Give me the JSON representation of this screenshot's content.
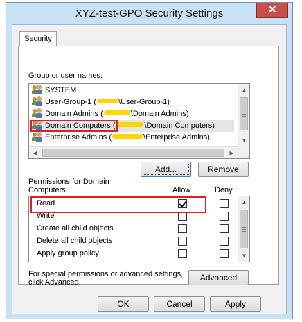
{
  "window": {
    "title": "XYZ-test-GPO Security Settings",
    "close_glyph": "✕"
  },
  "tabs": [
    {
      "label": "Security",
      "active": true
    }
  ],
  "group_section": {
    "label": "Group or user names:",
    "items": [
      {
        "prefix": "SYSTEM",
        "suffix": "",
        "redacted": false,
        "selected": false,
        "icon": "group-icon"
      },
      {
        "prefix": "User-Group-1 (",
        "suffix": "\\User-Group-1)",
        "redacted": true,
        "selected": false,
        "icon": "group-icon"
      },
      {
        "prefix": "Domain Admins (",
        "suffix": "\\Domain Admins)",
        "redacted": true,
        "selected": false,
        "icon": "group-icon"
      },
      {
        "prefix": "Domain Computers (",
        "suffix": "\\Domain Computers)",
        "redacted": true,
        "selected": true,
        "icon": "group-icon"
      },
      {
        "prefix": "Enterprise Admins (",
        "suffix": "\\Enterprise Admins)",
        "redacted": true,
        "selected": false,
        "icon": "group-icon"
      }
    ],
    "add_button": "Add...",
    "remove_button": "Remove"
  },
  "permissions": {
    "label_line1": "Permissions for Domain",
    "label_line2": "Computers",
    "allow_header": "Allow",
    "deny_header": "Deny",
    "rows": [
      {
        "name": "Read",
        "allow": true,
        "deny": false
      },
      {
        "name": "Write",
        "allow": false,
        "deny": false
      },
      {
        "name": "Create all child objects",
        "allow": false,
        "deny": false
      },
      {
        "name": "Delete all child objects",
        "allow": false,
        "deny": false
      },
      {
        "name": "Apply group policy",
        "allow": false,
        "deny": false
      }
    ]
  },
  "special": {
    "line1": "For special permissions or advanced settings,",
    "line2": "click Advanced.",
    "advanced_button": "Advanced"
  },
  "footer": {
    "ok": "OK",
    "cancel": "Cancel",
    "apply": "Apply"
  },
  "colors": {
    "highlight": "#e31b23",
    "redaction": "#ffd500",
    "close_button": "#c7514a"
  }
}
